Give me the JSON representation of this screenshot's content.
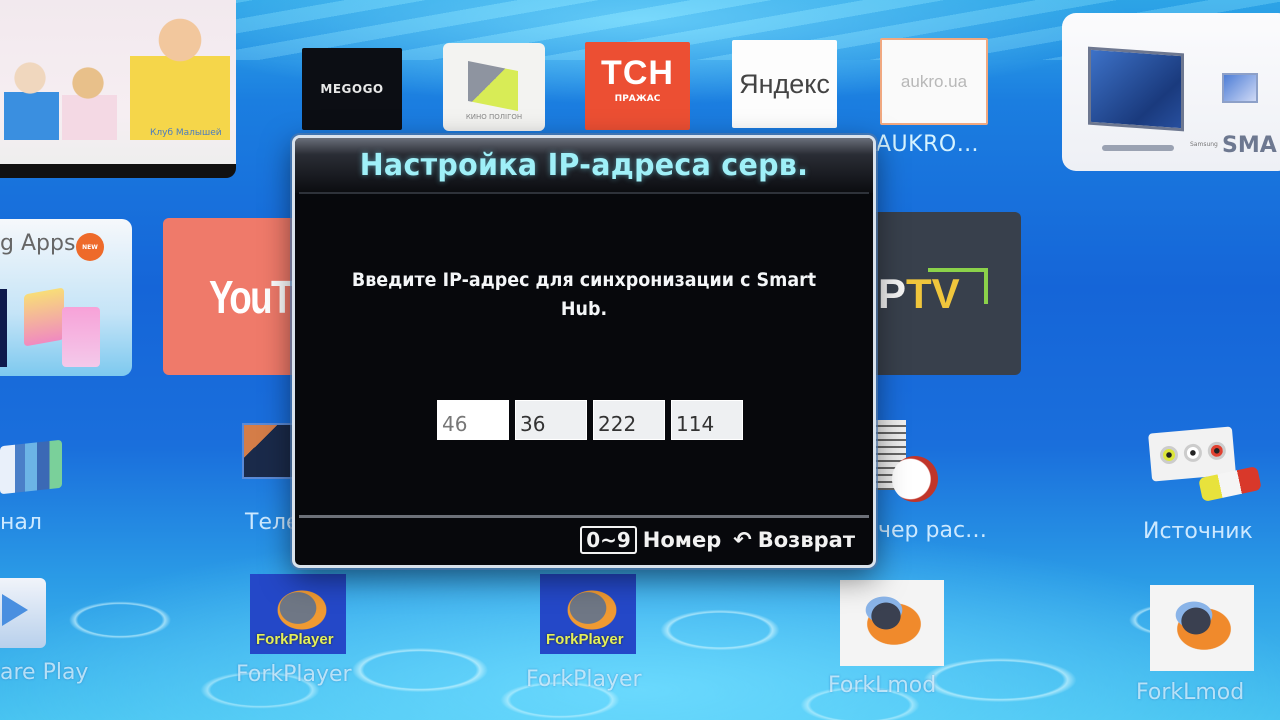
{
  "dialog": {
    "title": "Настройка IP-адреса серв.",
    "message": "Введите IP-адрес для синхронизации с Smart Hub.",
    "ip_fields": [
      {
        "value": "46",
        "active": true
      },
      {
        "value": "36",
        "active": false
      },
      {
        "value": "222",
        "active": false
      },
      {
        "value": "114",
        "active": false
      }
    ],
    "footer": {
      "number_key": "0~9",
      "number_label": "Номер",
      "return_icon": "↶",
      "return_label": "Возврат"
    }
  },
  "apps": {
    "top_row": {
      "megogo": "MEGOGO",
      "tsn_big": "ТСН",
      "tsn_sub": "ПРАЖАС",
      "kino_sub": "КИНО ПОЛІГОН",
      "yandex": "Яндекс",
      "aukro_logo": "aukro.ua",
      "aukro_label": "AUKRO…",
      "samsung_brand": "Samsung",
      "samsung_smart": "SMA",
      "promo_caption": "Клуб Малышей"
    },
    "middle_row": {
      "apps_label": "g Apps",
      "apps_badge": "NEW",
      "youtube": "YouT",
      "iptv_p": "P",
      "iptv_tv": "TV"
    },
    "third_row": {
      "channel_label": "нал",
      "tv_label": "Теле",
      "schedule_label": "чер рас…",
      "source_label": "Источник"
    },
    "bottom_row": {
      "share_play_label": "are Play",
      "forkplayer_1_label": "ForkPlayer",
      "forkplayer_2_label": "ForkPlayer",
      "forklmod_1_label": "ForkLmod",
      "forklmod_2_label": "ForkLmod",
      "fork_icon_text": "ForkPlayer"
    }
  },
  "colors": {
    "title_cyan": "#9ff0f8",
    "tsn_red": "#ec4f33",
    "youtube_red": "#ef7a6a",
    "background_blue": "#1565d8"
  }
}
